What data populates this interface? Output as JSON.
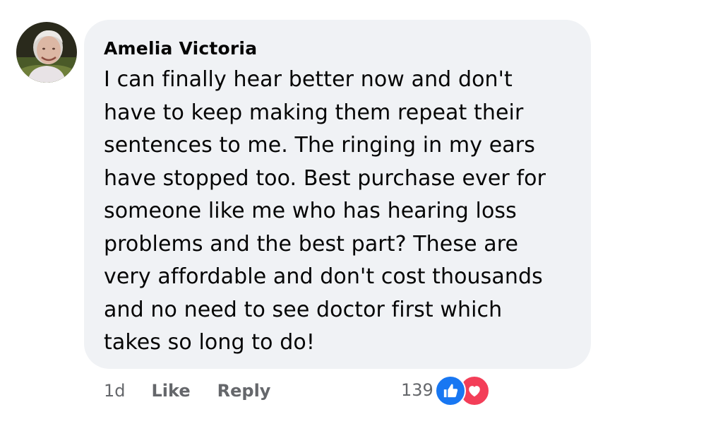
{
  "comment": {
    "author": "Amelia Victoria",
    "text": "I can finally hear better now and don't\nhave to keep making them repeat their\nsentences to me. The ringing in my ears\nhave stopped too. Best purchase ever for\nsomeone like me who has hearing loss\nproblems and the best part? These are\nvery affordable and don't cost thousands\nand no need to see doctor first which\ntakes so long to do!",
    "time": "1d",
    "like_label": "Like",
    "reply_label": "Reply",
    "reaction_count": "139",
    "reactions": [
      "like-icon",
      "love-icon"
    ]
  },
  "colors": {
    "bubble": "#f0f2f5",
    "text": "#050505",
    "meta": "#65676b",
    "like": "#1877f2",
    "love": "#f33e58"
  }
}
